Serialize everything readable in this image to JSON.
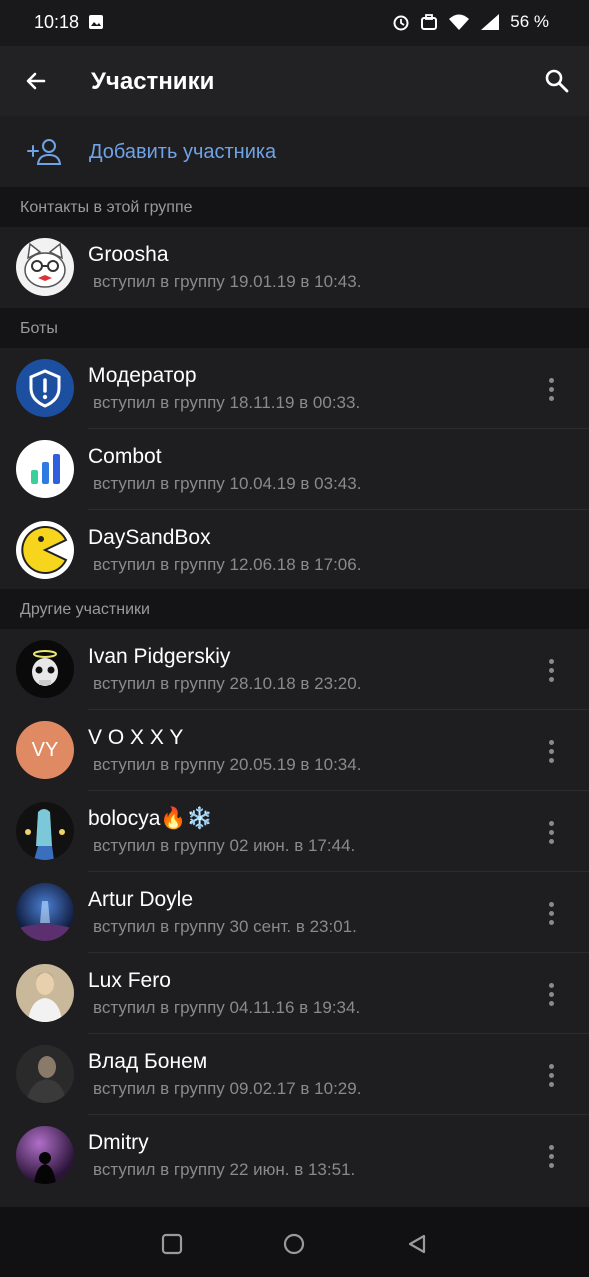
{
  "status_bar": {
    "time": "10:18",
    "battery": "56 %"
  },
  "toolbar": {
    "title": "Участники"
  },
  "add_member": {
    "label": "Добавить участника"
  },
  "sections": {
    "contacts": "Контакты в этой группе",
    "bots": "Боты",
    "others": "Другие участники"
  },
  "members": [
    {
      "name": "Groosha",
      "joined": "вступил в группу 19.01.19 в 10:43."
    },
    {
      "name": "Модератор",
      "joined": "вступил в группу 18.11.19 в 00:33."
    },
    {
      "name": "Combot",
      "joined": "вступил в группу 10.04.19 в 03:43."
    },
    {
      "name": "DaySandBox",
      "joined": "вступил в группу 12.06.18 в 17:06."
    },
    {
      "name": "Ivan Pidgerskiy",
      "joined": "вступил в группу 28.10.18 в 23:20."
    },
    {
      "name": "V O X X Y",
      "joined": "вступил в группу 20.05.19 в 10:34.",
      "initials": "VY",
      "avatar_color": "#e08a63"
    },
    {
      "name": "bolocya🔥❄️",
      "joined": "вступил в группу 02 июн. в 17:44."
    },
    {
      "name": "Artur Doyle",
      "joined": "вступил в группу 30 сент. в 23:01."
    },
    {
      "name": "Lux Fero",
      "joined": "вступил в группу 04.11.16 в 19:34."
    },
    {
      "name": "Влад Бонем",
      "joined": "вступил в группу 09.02.17 в 10:29."
    },
    {
      "name": "Dmitry",
      "joined": "вступил в группу 22 июн. в 13:51."
    }
  ],
  "colors": {
    "accent": "#6fa3e6",
    "background": "#1e1e20",
    "section_bg": "#141416"
  }
}
